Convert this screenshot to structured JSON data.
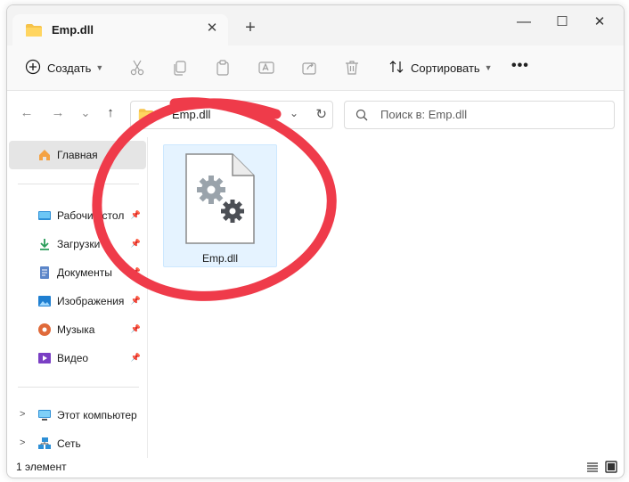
{
  "window": {
    "tab_title": "Emp.dll",
    "tab_close": "✕",
    "new_tab": "+",
    "minimize": "—",
    "maximize": "☐",
    "close": "✕"
  },
  "toolbar": {
    "create_label": "Создать",
    "sort_label": "Сортировать",
    "more_label": "•••"
  },
  "nav": {
    "back": "←",
    "forward": "→",
    "recent": "⌄",
    "up": "↑",
    "address_text": "Emp.dll",
    "address_caret": "⌄",
    "refresh": "↻",
    "search_placeholder": "Поиск в: Emp.dll"
  },
  "sidebar": {
    "items": [
      {
        "label": "Главная",
        "icon": "home-icon"
      },
      {
        "label": "Рабочий стол",
        "icon": "desktop-icon",
        "pin": "📌"
      },
      {
        "label": "Загрузки",
        "icon": "download-icon",
        "pin": "📌"
      },
      {
        "label": "Документы",
        "icon": "documents-icon",
        "pin": "📌"
      },
      {
        "label": "Изображения",
        "icon": "pictures-icon",
        "pin": "📌"
      },
      {
        "label": "Музыка",
        "icon": "music-icon",
        "pin": "📌"
      },
      {
        "label": "Видео",
        "icon": "videos-icon",
        "pin": "📌"
      },
      {
        "label": "Этот компьютер",
        "icon": "computer-icon",
        "chevron": ">"
      },
      {
        "label": "Сеть",
        "icon": "network-icon",
        "chevron": ">"
      }
    ]
  },
  "content": {
    "files": [
      {
        "name": "Emp.dll",
        "icon": "dll-file-icon",
        "selected": true
      }
    ]
  },
  "status": {
    "count_text": "1 элемент"
  },
  "colors": {
    "annotation_circle": "#ef3b4a",
    "selection_fill": "#e5f3ff",
    "selection_border": "#cde8ff",
    "folder": "#f6c34a"
  }
}
